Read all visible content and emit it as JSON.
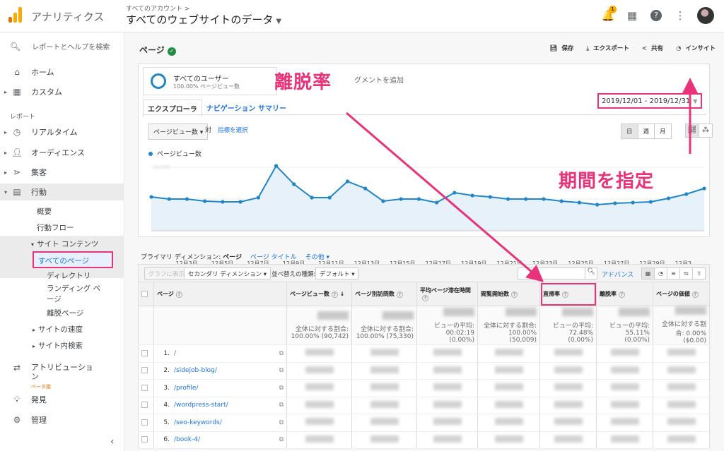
{
  "header": {
    "app_title": "アナリティクス",
    "account_crumb": "すべてのアカウント >",
    "view_name": "すべてのウェブサイトのデータ",
    "notification_count": "1"
  },
  "sidebar": {
    "search_placeholder": "レポートとヘルプを検索",
    "home": "ホーム",
    "custom": "カスタム",
    "reports_section": "レポート",
    "realtime": "リアルタイム",
    "audience": "オーディエンス",
    "acquisition": "集客",
    "behavior": "行動",
    "overview": "概要",
    "behavior_flow": "行動フロー",
    "site_content": "サイト コンテンツ",
    "all_pages": "すべてのページ",
    "directory": "ディレクトリ",
    "landing_pages": "ランディング ページ",
    "exit_pages": "離脱ページ",
    "site_speed": "サイトの速度",
    "site_search": "サイト内検索",
    "attribution": "アトリビューション",
    "attribution_beta": "ベータ版",
    "discover": "発見",
    "admin": "管理"
  },
  "page": {
    "title": "ページ",
    "actions": {
      "save": "保存",
      "export": "エクスポート",
      "share": "共有",
      "insights": "インサイト"
    },
    "segment_name": "すべてのユーザー",
    "segment_sub": "100.00% ページビュー数",
    "segment_add": "グメントを追加",
    "date_range": "2019/12/01 - 2019/12/31",
    "tabs": [
      "エクスプローラ",
      "ナビゲーション サマリー"
    ],
    "metric_select": "ページビュー数",
    "versus": "対",
    "pick_metric": "指標を選択",
    "granularity": [
      "日",
      "週",
      "月"
    ],
    "legend": "ページビュー数"
  },
  "chart_data": {
    "type": "line",
    "series": [
      {
        "name": "ページビュー数",
        "values": [
          0.48,
          0.45,
          0.45,
          0.42,
          0.41,
          0.41,
          0.47,
          0.92,
          0.66,
          0.47,
          0.47,
          0.7,
          0.6,
          0.42,
          0.45,
          0.45,
          0.4,
          0.54,
          0.5,
          0.48,
          0.45,
          0.45,
          0.45,
          0.42,
          0.4,
          0.37,
          0.39,
          0.4,
          0.41,
          0.46,
          0.52,
          0.6
        ]
      }
    ],
    "x_ticks": [
      "...",
      "12月3日",
      "12月5日",
      "12月7日",
      "12月9日",
      "12月11日",
      "12月13日",
      "12月15日",
      "12月17日",
      "12月19日",
      "12月21日",
      "12月23日",
      "12月25日",
      "12月27日",
      "12月29日",
      "12月3..."
    ],
    "color": "#1f86c8",
    "grid": true
  },
  "table_controls": {
    "primary_dim_label": "プライマリ ディメンション:",
    "primary_dim": "ページ",
    "alt_dim": "ページ タイトル",
    "other": "その他",
    "chart_rows": "グラフに表示",
    "secondary_dim": "セカンダリ ディメンション",
    "sort_type_label": "並べ替えの種類:",
    "sort_type": "デフォルト",
    "advanced": "アドバンス"
  },
  "table": {
    "headers": [
      "ページ",
      "ページビュー数",
      "ページ別訪問数",
      "平均ページ滞在時間",
      "閲覧開始数",
      "直帰率",
      "離脱率",
      "ページの価値"
    ],
    "totals": [
      "全体に対する割合: 100.00% (90,742)",
      "全体に対する割合: 100.00% (75,330)",
      "ビューの平均: 00:02:19 (0.00%)",
      "全体に対する割合: 100.00% (50,009)",
      "ビューの平均: 72.48% (0.00%)",
      "ビューの平均: 55.11% (0.00%)",
      "全体に対する割合: 0.00% ($0.00)"
    ],
    "rows": [
      {
        "num": "1.",
        "page": "/"
      },
      {
        "num": "2.",
        "page": "/sidejob-blog/"
      },
      {
        "num": "3.",
        "page": "/profile/"
      },
      {
        "num": "4.",
        "page": "/wordpress-start/"
      },
      {
        "num": "5.",
        "page": "/seo-keywords/"
      },
      {
        "num": "6.",
        "page": "/book-4/"
      }
    ]
  },
  "annotations": {
    "exit_rate": "離脱率",
    "set_period": "期間を指定",
    "color": "#e8337a"
  }
}
